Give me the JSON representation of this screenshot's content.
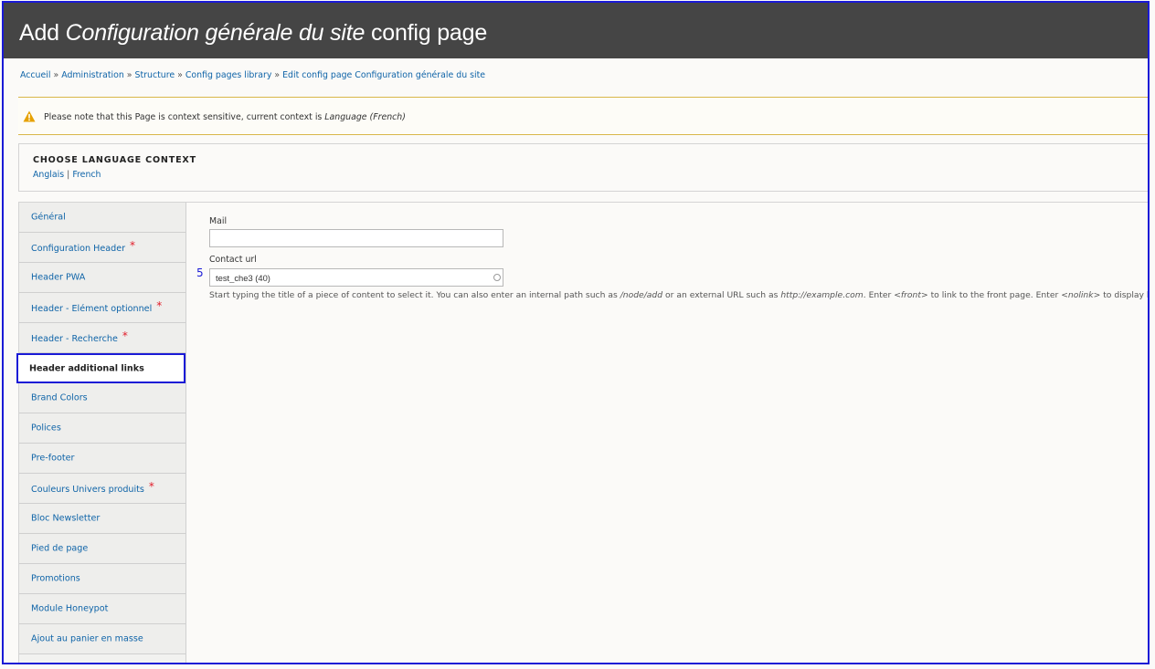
{
  "header": {
    "title_prefix": "Add",
    "title_italic": "Configuration générale du site",
    "title_suffix": "config page"
  },
  "breadcrumb": [
    "Accueil",
    "Administration",
    "Structure",
    "Config pages library",
    "Edit config page Configuration générale du site"
  ],
  "breadcrumb_separator": "»",
  "warning": {
    "icon": "warning-triangle-icon",
    "text": "Please note that this Page is context sensitive, current context is",
    "context": "Language (French)"
  },
  "language_context": {
    "title": "CHOOSE LANGUAGE CONTEXT",
    "links": [
      "Anglais",
      "French"
    ],
    "separator": "|"
  },
  "vertical_tabs": [
    {
      "label": "Général",
      "required": false,
      "active": false
    },
    {
      "label": "Configuration Header",
      "required": true,
      "active": false
    },
    {
      "label": "Header PWA",
      "required": false,
      "active": false
    },
    {
      "label": "Header - Elément optionnel",
      "required": true,
      "active": false
    },
    {
      "label": "Header - Recherche",
      "required": true,
      "active": false
    },
    {
      "label": "Header additional links",
      "required": false,
      "active": true
    },
    {
      "label": "Brand Colors",
      "required": false,
      "active": false
    },
    {
      "label": "Polices",
      "required": false,
      "active": false
    },
    {
      "label": "Pre-footer",
      "required": false,
      "active": false
    },
    {
      "label": "Couleurs Univers produits",
      "required": true,
      "active": false
    },
    {
      "label": "Bloc Newsletter",
      "required": false,
      "active": false
    },
    {
      "label": "Pied de page",
      "required": false,
      "active": false
    },
    {
      "label": "Promotions",
      "required": false,
      "active": false
    },
    {
      "label": "Module Honeypot",
      "required": false,
      "active": false
    },
    {
      "label": "Ajout au panier en masse",
      "required": false,
      "active": false
    }
  ],
  "required_marker": "*",
  "form": {
    "mail": {
      "label": "Mail",
      "value": ""
    },
    "contact_url": {
      "label": "Contact url",
      "value": "test_che3 (40)",
      "row_marker": "5",
      "description": {
        "t1": "Start typing the title of a piece of content to select it. You can also enter an internal path such as",
        "e1": "/node/add",
        "t2": "or an external URL such as",
        "e2": "http://example.com",
        "t3": ". Enter",
        "e3": "<front>",
        "t4": "to link to the front page. Enter",
        "e4": "<nolink>",
        "t5": "to display link text only."
      }
    }
  },
  "colors": {
    "header_bg": "#454545",
    "link": "#0f64a8",
    "highlight": "#1a1ad6",
    "required": "#e11d2a",
    "warning": "#e6a100"
  }
}
